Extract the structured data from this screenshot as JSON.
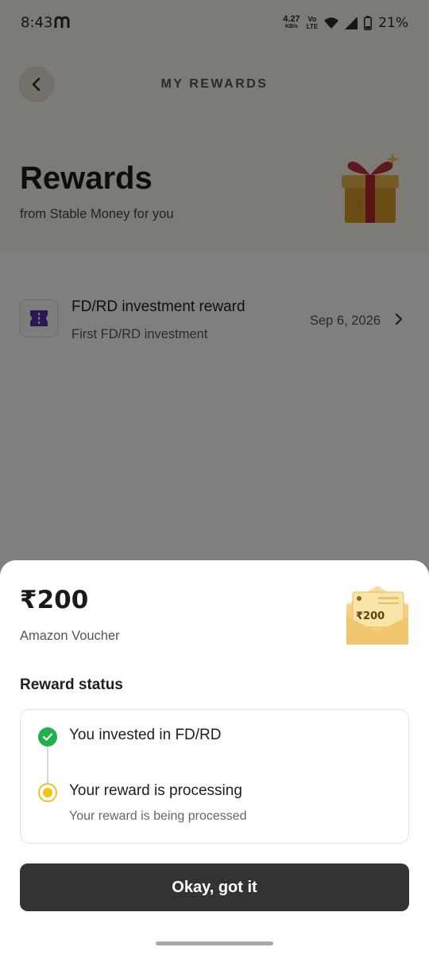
{
  "status_bar": {
    "time": "8:43",
    "network_speed": "4.27",
    "network_unit": "KB/s",
    "network_type_top": "Vo",
    "network_type_bottom": "LTE",
    "battery": "21%"
  },
  "header": {
    "title": "MY REWARDS",
    "back_icon": "chevron-left-icon"
  },
  "hero": {
    "title": "Rewards",
    "subtitle": "from Stable Money for you",
    "image_icon": "gift-box-icon"
  },
  "rewards_list": [
    {
      "title": "FD/RD investment reward",
      "subtitle": "First FD/RD investment",
      "date": "Sep 6, 2026",
      "icon": "ticket-icon"
    }
  ],
  "sheet": {
    "amount": "₹200",
    "voucher_name": "Amazon Voucher",
    "voucher_image_amount": "₹200",
    "status_heading": "Reward status",
    "steps": [
      {
        "title": "You invested in FD/RD",
        "state": "done"
      },
      {
        "title": "Your reward is processing",
        "subtitle": "Your reward is being processed",
        "state": "pending"
      }
    ],
    "button_label": "Okay, got it"
  },
  "colors": {
    "hero_bg": "#fbf6ec",
    "button_bg": "#333333",
    "done_green": "#22b04b",
    "pending_yellow": "#f1c21b",
    "ticket_purple": "#5b2ea6"
  }
}
